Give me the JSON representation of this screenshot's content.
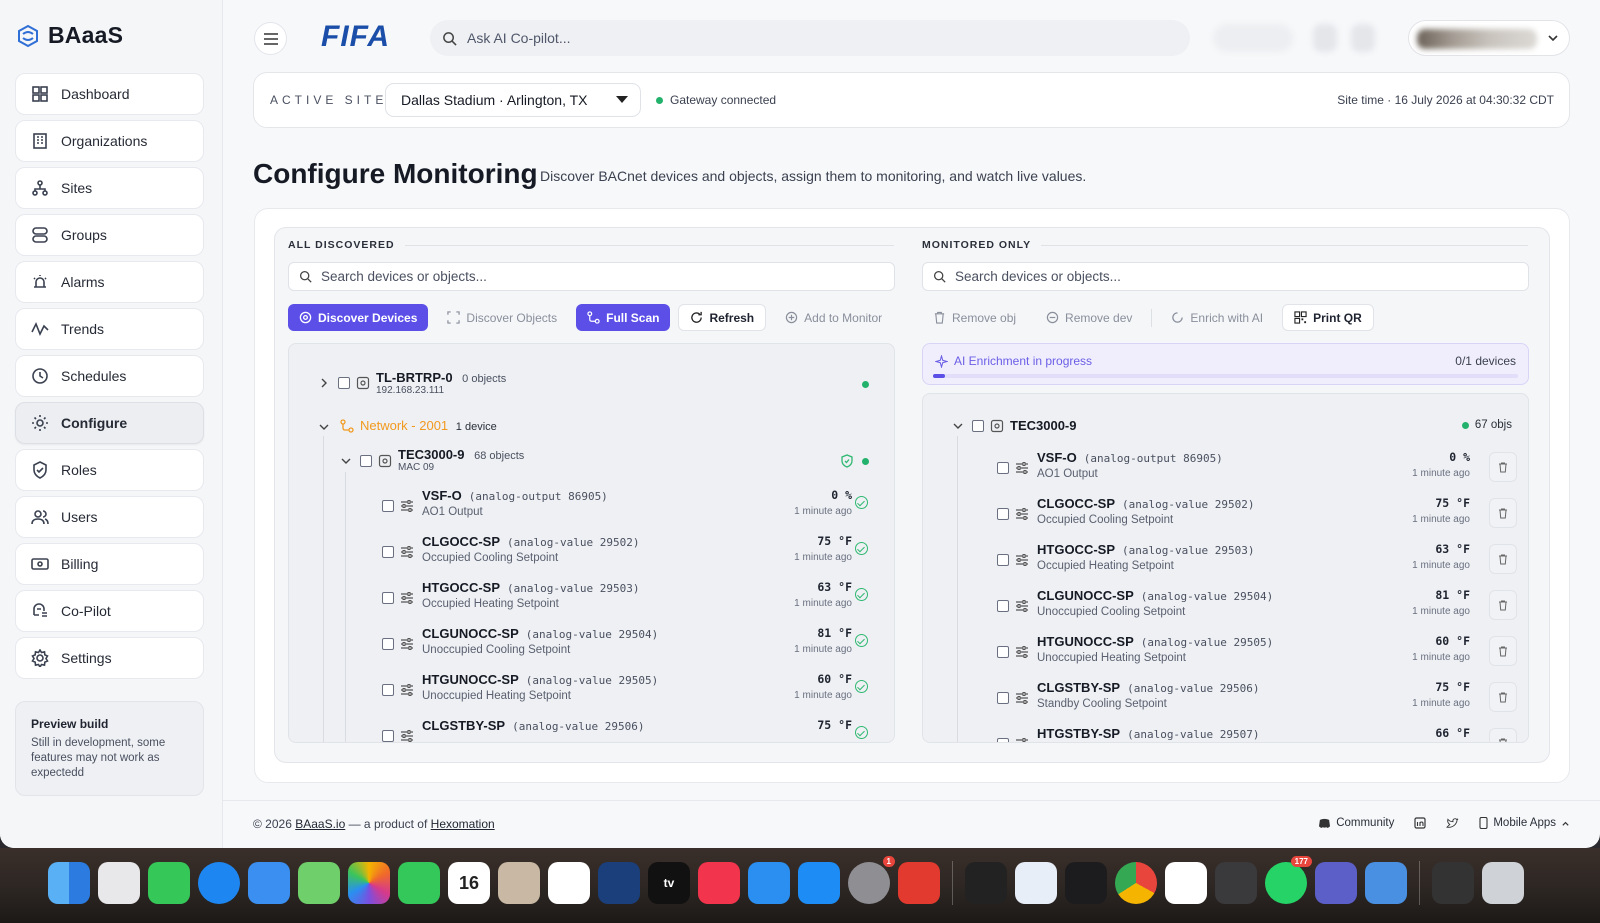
{
  "app": {
    "name": "BAaaS",
    "org_logo": "FIFA"
  },
  "sidebar": {
    "items": [
      {
        "label": "Dashboard",
        "icon": "dashboard-icon"
      },
      {
        "label": "Organizations",
        "icon": "building-icon"
      },
      {
        "label": "Sites",
        "icon": "sites-icon"
      },
      {
        "label": "Groups",
        "icon": "groups-icon"
      },
      {
        "label": "Alarms",
        "icon": "alarm-icon"
      },
      {
        "label": "Trends",
        "icon": "trend-icon"
      },
      {
        "label": "Schedules",
        "icon": "clock-icon"
      },
      {
        "label": "Configure",
        "icon": "gear-icon",
        "active": true
      },
      {
        "label": "Roles",
        "icon": "shield-icon"
      },
      {
        "label": "Users",
        "icon": "users-icon"
      },
      {
        "label": "Billing",
        "icon": "billing-icon"
      },
      {
        "label": "Co-Pilot",
        "icon": "copilot-icon"
      },
      {
        "label": "Settings",
        "icon": "settings-icon"
      }
    ],
    "preview": {
      "title": "Preview build",
      "text": "Still in development, some features may not work as expectedd"
    }
  },
  "topbar": {
    "search_placeholder": "Ask AI Co-pilot..."
  },
  "site": {
    "label": "ACTIVE SITE",
    "selected": "Dallas Stadium · Arlington, TX",
    "gateway": "Gateway connected",
    "time": "Site time · 16 July 2026 at 04:30:32 CDT"
  },
  "page": {
    "title": "Configure Monitoring",
    "subtitle": "Discover BACnet devices and objects, assign them to monitoring, and watch live values."
  },
  "left": {
    "heading": "ALL DISCOVERED",
    "search_placeholder": "Search devices or objects...",
    "buttons": {
      "discover_devices": "Discover Devices",
      "discover_objects": "Discover Objects",
      "full_scan": "Full Scan",
      "refresh": "Refresh",
      "add_to_monitor": "Add to Monitor"
    },
    "device1": {
      "name": "TL-BRTRP-0",
      "count": "0 objects",
      "ip": "192.168.23.111"
    },
    "network": {
      "name": "Network - 2001",
      "count": "1 device"
    },
    "device2": {
      "name": "TEC3000-9",
      "count": "68 objects",
      "mac": "MAC 09"
    },
    "objects": [
      {
        "name": "VSF-O",
        "type": "(analog-output 86905)",
        "desc": "AO1 Output",
        "value": "0 %",
        "ago": "1 minute ago"
      },
      {
        "name": "CLGOCC-SP",
        "type": "(analog-value 29502)",
        "desc": "Occupied Cooling Setpoint",
        "value": "75 °F",
        "ago": "1 minute ago"
      },
      {
        "name": "HTGOCC-SP",
        "type": "(analog-value 29503)",
        "desc": "Occupied Heating Setpoint",
        "value": "63 °F",
        "ago": "1 minute ago"
      },
      {
        "name": "CLGUNOCC-SP",
        "type": "(analog-value 29504)",
        "desc": "Unoccupied Cooling Setpoint",
        "value": "81 °F",
        "ago": "1 minute ago"
      },
      {
        "name": "HTGUNOCC-SP",
        "type": "(analog-value 29505)",
        "desc": "Unoccupied Heating Setpoint",
        "value": "60 °F",
        "ago": "1 minute ago"
      },
      {
        "name": "CLGSTBY-SP",
        "type": "(analog-value 29506)",
        "desc": "",
        "value": "75 °F",
        "ago": ""
      }
    ]
  },
  "right": {
    "heading": "MONITORED ONLY",
    "search_placeholder": "Search devices or objects...",
    "buttons": {
      "remove_obj": "Remove obj",
      "remove_dev": "Remove dev",
      "enrich": "Enrich with AI",
      "print_qr": "Print QR"
    },
    "ai": {
      "label": "AI Enrichment in progress",
      "count": "0/1 devices",
      "progress": 0.02
    },
    "device": {
      "name": "TEC3000-9",
      "count": "67 objs"
    },
    "objects": [
      {
        "name": "VSF-O",
        "type": "(analog-output 86905)",
        "desc": "AO1 Output",
        "value": "0 %",
        "ago": "1 minute ago"
      },
      {
        "name": "CLGOCC-SP",
        "type": "(analog-value 29502)",
        "desc": "Occupied Cooling Setpoint",
        "value": "75 °F",
        "ago": "1 minute ago"
      },
      {
        "name": "HTGOCC-SP",
        "type": "(analog-value 29503)",
        "desc": "Occupied Heating Setpoint",
        "value": "63 °F",
        "ago": "1 minute ago"
      },
      {
        "name": "CLGUNOCC-SP",
        "type": "(analog-value 29504)",
        "desc": "Unoccupied Cooling Setpoint",
        "value": "81 °F",
        "ago": "1 minute ago"
      },
      {
        "name": "HTGUNOCC-SP",
        "type": "(analog-value 29505)",
        "desc": "Unoccupied Heating Setpoint",
        "value": "60 °F",
        "ago": "1 minute ago"
      },
      {
        "name": "CLGSTBY-SP",
        "type": "(analog-value 29506)",
        "desc": "Standby Cooling Setpoint",
        "value": "75 °F",
        "ago": "1 minute ago"
      },
      {
        "name": "HTGSTBY-SP",
        "type": "(analog-value 29507)",
        "desc": "",
        "value": "66 °F",
        "ago": ""
      }
    ]
  },
  "footer": {
    "copyright_prefix": "© 2026 ",
    "site_link": "BAaaS.io",
    "middle": " — a product of ",
    "company_link": "Hexomation",
    "community": "Community",
    "mobile_apps": "Mobile Apps"
  },
  "dock": {
    "calendar_day": "16",
    "settings_badge": "1",
    "whatsapp_badge": "177",
    "tv_label": "tv"
  },
  "colors": {
    "accent": "#5b4fe8",
    "success": "#22b26b",
    "network": "#f29a20",
    "brand": "#1b4ea8"
  }
}
